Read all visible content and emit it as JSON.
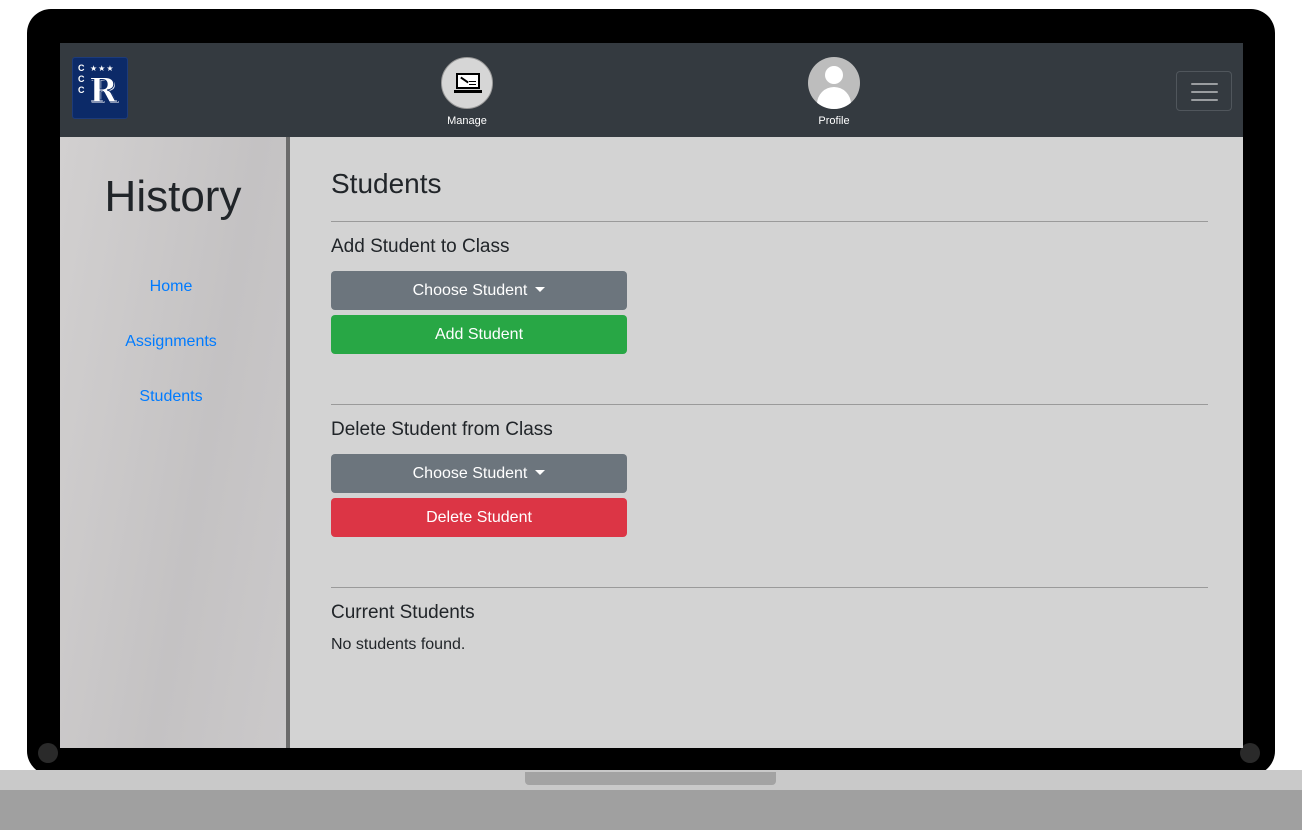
{
  "navbar": {
    "logo_letter": "R",
    "items": [
      {
        "label": "Manage",
        "icon": "laptop-icon"
      },
      {
        "label": "Profile",
        "icon": "avatar-icon"
      }
    ],
    "menu_icon": "hamburger-icon"
  },
  "sidebar": {
    "title": "History",
    "links": [
      {
        "label": "Home"
      },
      {
        "label": "Assignments"
      },
      {
        "label": "Students"
      }
    ]
  },
  "main": {
    "title": "Students",
    "add_section": {
      "title": "Add Student to Class",
      "dropdown_label": "Choose Student",
      "button_label": "Add Student"
    },
    "delete_section": {
      "title": "Delete Student from Class",
      "dropdown_label": "Choose Student",
      "button_label": "Delete Student"
    },
    "current_section": {
      "title": "Current Students",
      "empty_text": "No students found."
    }
  },
  "colors": {
    "navbar": "#343a40",
    "link": "#007bff",
    "secondary": "#6c757d",
    "success": "#28a745",
    "danger": "#dc3545"
  }
}
